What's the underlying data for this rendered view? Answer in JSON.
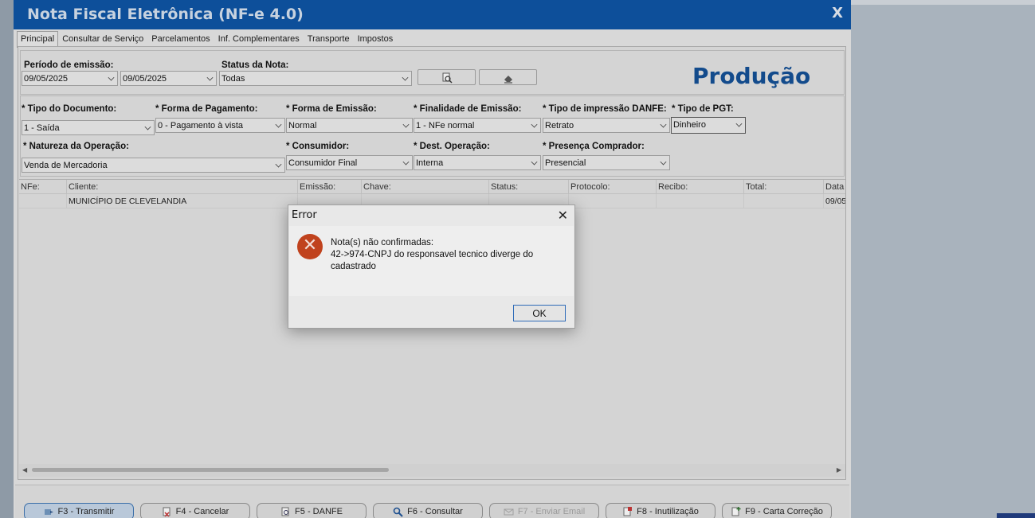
{
  "window": {
    "title": "Nota Fiscal Eletrônica (NF-e 4.0)",
    "close_label": "X"
  },
  "tabs": [
    {
      "label": "Principal"
    },
    {
      "label": "Consultar de Serviço"
    },
    {
      "label": "Parcelamentos"
    },
    {
      "label": "Inf. Complementares"
    },
    {
      "label": "Transporte"
    },
    {
      "label": "Impostos"
    }
  ],
  "filters": {
    "periodo_label": "Período de emissão:",
    "data_inicio": "09/05/2025",
    "data_fim": "09/05/2025",
    "status_label": "Status da Nota:",
    "status_value": "Todas",
    "ambiente": "Produção"
  },
  "form": {
    "tipo_doc_label": "* Tipo do Documento:",
    "tipo_doc_value": "1 - Saída",
    "forma_pag_label": "* Forma de Pagamento:",
    "forma_pag_value": "0 - Pagamento à vista",
    "forma_emissao_label": "* Forma de Emissão:",
    "forma_emissao_value": "Normal",
    "finalidade_label": "* Finalidade de Emissão:",
    "finalidade_value": "1 - NFe normal",
    "tipo_impressao_label": "* Tipo de impressão DANFE:",
    "tipo_impressao_value": "Retrato",
    "tipo_pgt_label": "* Tipo de PGT:",
    "tipo_pgt_value": "Dinheiro",
    "natureza_label": "* Natureza da Operação:",
    "natureza_value": "Venda de Mercadoria",
    "consumidor_label": "* Consumidor:",
    "consumidor_value": "Consumidor Final",
    "dest_label": "* Dest. Operação:",
    "dest_value": "Interna",
    "presenca_label": "* Presença Comprador:",
    "presenca_value": "Presencial"
  },
  "grid": {
    "columns": [
      "NFe:",
      "Cliente:",
      "Emissão:",
      "Chave:",
      "Status:",
      "Protocolo:",
      "Recibo:",
      "Total:",
      "Data"
    ],
    "rows": [
      [
        "",
        "MUNICÍPIO  DE CLEVELANDIA",
        "",
        "",
        "",
        "",
        "",
        "",
        "09/05"
      ]
    ]
  },
  "footer": {
    "buttons": [
      {
        "label": "F3 - Transmitir"
      },
      {
        "label": "F4 - Cancelar"
      },
      {
        "label": "F5 - DANFE"
      },
      {
        "label": "F6 - Consultar"
      },
      {
        "label": "F7 - Enviar Email"
      },
      {
        "label": "F8 - Inutilização"
      },
      {
        "label": "F9 - Carta Correção"
      }
    ]
  },
  "dialog": {
    "title": "Error",
    "line1": "Nota(s) não confirmadas:",
    "line2": "42->974-CNPJ do responsavel tecnico diverge do",
    "line3": "cadastrado",
    "ok_label": "OK",
    "icon": "error-x-icon"
  },
  "colors": {
    "title_bar": "#0d4f9a",
    "producao": "#134b8c",
    "error_icon": "#c0421d"
  }
}
